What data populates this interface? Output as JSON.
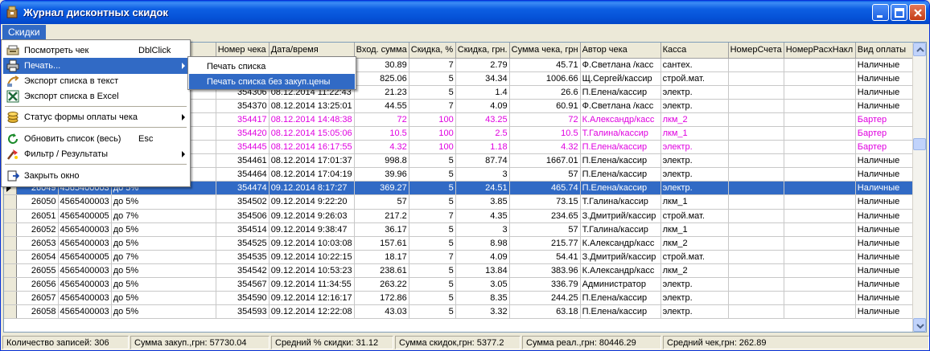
{
  "window": {
    "title": "Журнал дисконтных скидок"
  },
  "menubar": {
    "items": [
      "Скидки"
    ]
  },
  "dropdown": {
    "items": [
      {
        "label": "Посмотреть чек",
        "shortcut": "DblClick",
        "icon": "receipt-view-icon",
        "submenu": false
      },
      {
        "label": "Печать...",
        "shortcut": "",
        "icon": "printer-icon",
        "submenu": true,
        "highlighted": true
      },
      {
        "label": "Экспорт списка в текст",
        "shortcut": "",
        "icon": "export-text-icon",
        "submenu": false
      },
      {
        "label": "Экспорт списка в Excel",
        "shortcut": "",
        "icon": "excel-icon",
        "submenu": false
      },
      {
        "label": "Статус формы оплаты чека",
        "shortcut": "",
        "icon": "coins-icon",
        "submenu": true
      },
      {
        "label": "Обновить список (весь)",
        "shortcut": "Esc",
        "icon": "refresh-icon",
        "submenu": false
      },
      {
        "label": "Фильтр / Результаты",
        "shortcut": "",
        "icon": "filter-icon",
        "submenu": true
      },
      {
        "label": "Закрыть окно",
        "shortcut": "",
        "icon": "close-window-icon",
        "submenu": false
      }
    ]
  },
  "submenu": {
    "items": [
      {
        "label": "Печать списка",
        "highlighted": false
      },
      {
        "label": "Печать списка без закуп.цены",
        "highlighted": true
      }
    ]
  },
  "grid": {
    "columns": [
      "",
      "",
      "",
      "Номер чека",
      "Дата/время",
      "Вход. сумма",
      "Скидка, %",
      "Скидка, грн.",
      "Сумма чека, грн",
      "Автор чека",
      "Касса",
      "НомерСчета",
      "НомерРасхНакл",
      "Вид оплаты"
    ],
    "rows": [
      {
        "id": "",
        "card": "",
        "level": "",
        "receipt": "",
        "datetime": "",
        "input": "30.89",
        "pct": "7",
        "disc": "2.79",
        "total": "45.71",
        "author": "Ф.Светлана /касс",
        "kassa": "сантех.",
        "acc": "",
        "inv": "",
        "pay": "Наличные",
        "style": "normal"
      },
      {
        "id": "",
        "card": "",
        "level": "",
        "receipt": "",
        "datetime": "",
        "input": "825.06",
        "pct": "5",
        "disc": "34.34",
        "total": "1006.66",
        "author": "Щ.Сергей/кассир",
        "kassa": "строй.мат.",
        "acc": "",
        "inv": "",
        "pay": "Наличные",
        "style": "normal"
      },
      {
        "id": "",
        "card": "",
        "level": "",
        "receipt": "354306",
        "datetime": "08.12.2014 11:22:43",
        "input": "21.23",
        "pct": "5",
        "disc": "1.4",
        "total": "26.6",
        "author": "П.Елена/кассир",
        "kassa": "электр.",
        "acc": "",
        "inv": "",
        "pay": "Наличные",
        "style": "normal"
      },
      {
        "id": "",
        "card": "",
        "level": "",
        "receipt": "354370",
        "datetime": "08.12.2014 13:25:01",
        "input": "44.55",
        "pct": "7",
        "disc": "4.09",
        "total": "60.91",
        "author": "Ф.Светлана /касс",
        "kassa": "электр.",
        "acc": "",
        "inv": "",
        "pay": "Наличные",
        "style": "normal"
      },
      {
        "id": "",
        "card": "",
        "level": "",
        "receipt": "354417",
        "datetime": "08.12.2014 14:48:38",
        "input": "72",
        "pct": "100",
        "disc": "43.25",
        "total": "72",
        "author": "К.Александр/касс",
        "kassa": "лкм_2",
        "acc": "",
        "inv": "",
        "pay": "Бартер",
        "style": "pink"
      },
      {
        "id": "",
        "card": "",
        "level": "",
        "receipt": "354420",
        "datetime": "08.12.2014 15:05:06",
        "input": "10.5",
        "pct": "100",
        "disc": "2.5",
        "total": "10.5",
        "author": "Т.Галина/кассир",
        "kassa": "лкм_1",
        "acc": "",
        "inv": "",
        "pay": "Бартер",
        "style": "pink"
      },
      {
        "id": "",
        "card": "",
        "level": "а барт",
        "receipt": "354445",
        "datetime": "08.12.2014 16:17:55",
        "input": "4.32",
        "pct": "100",
        "disc": "1.18",
        "total": "4.32",
        "author": "П.Елена/кассир",
        "kassa": "электр.",
        "acc": "",
        "inv": "",
        "pay": "Бартер",
        "style": "pink"
      },
      {
        "id": "",
        "card": "",
        "level": "",
        "receipt": "354461",
        "datetime": "08.12.2014 17:01:37",
        "input": "998.8",
        "pct": "5",
        "disc": "87.74",
        "total": "1667.01",
        "author": "П.Елена/кассир",
        "kassa": "электр.",
        "acc": "",
        "inv": "",
        "pay": "Наличные",
        "style": "normal"
      },
      {
        "id": "",
        "card": "",
        "level": "",
        "receipt": "354464",
        "datetime": "08.12.2014 17:04:19",
        "input": "39.96",
        "pct": "5",
        "disc": "3",
        "total": "57",
        "author": "П.Елена/кассир",
        "kassa": "электр.",
        "acc": "",
        "inv": "",
        "pay": "Наличные",
        "style": "normal"
      },
      {
        "id": "26049",
        "card": "4565400003",
        "level": "до 5%",
        "receipt": "354474",
        "datetime": "09.12.2014 8:17:27",
        "input": "369.27",
        "pct": "5",
        "disc": "24.51",
        "total": "465.74",
        "author": "П.Елена/кассир",
        "kassa": "электр.",
        "acc": "",
        "inv": "",
        "pay": "Наличные",
        "style": "sel"
      },
      {
        "id": "26050",
        "card": "4565400003",
        "level": "до 5%",
        "receipt": "354502",
        "datetime": "09.12.2014 9:22:20",
        "input": "57",
        "pct": "5",
        "disc": "3.85",
        "total": "73.15",
        "author": "Т.Галина/кассир",
        "kassa": "лкм_1",
        "acc": "",
        "inv": "",
        "pay": "Наличные",
        "style": "normal"
      },
      {
        "id": "26051",
        "card": "4565400005",
        "level": "до 7%",
        "receipt": "354506",
        "datetime": "09.12.2014 9:26:03",
        "input": "217.2",
        "pct": "7",
        "disc": "4.35",
        "total": "234.65",
        "author": "З.Дмитрий/кассир",
        "kassa": "строй.мат.",
        "acc": "",
        "inv": "",
        "pay": "Наличные",
        "style": "normal"
      },
      {
        "id": "26052",
        "card": "4565400003",
        "level": "до 5%",
        "receipt": "354514",
        "datetime": "09.12.2014 9:38:47",
        "input": "36.17",
        "pct": "5",
        "disc": "3",
        "total": "57",
        "author": "Т.Галина/кассир",
        "kassa": "лкм_1",
        "acc": "",
        "inv": "",
        "pay": "Наличные",
        "style": "normal"
      },
      {
        "id": "26053",
        "card": "4565400003",
        "level": "до 5%",
        "receipt": "354525",
        "datetime": "09.12.2014 10:03:08",
        "input": "157.61",
        "pct": "5",
        "disc": "8.98",
        "total": "215.77",
        "author": "К.Александр/касс",
        "kassa": "лкм_2",
        "acc": "",
        "inv": "",
        "pay": "Наличные",
        "style": "normal"
      },
      {
        "id": "26054",
        "card": "4565400005",
        "level": "до 7%",
        "receipt": "354535",
        "datetime": "09.12.2014 10:22:15",
        "input": "18.17",
        "pct": "7",
        "disc": "4.09",
        "total": "54.41",
        "author": "З.Дмитрий/кассир",
        "kassa": "строй.мат.",
        "acc": "",
        "inv": "",
        "pay": "Наличные",
        "style": "normal"
      },
      {
        "id": "26055",
        "card": "4565400003",
        "level": "до 5%",
        "receipt": "354542",
        "datetime": "09.12.2014 10:53:23",
        "input": "238.61",
        "pct": "5",
        "disc": "13.84",
        "total": "383.96",
        "author": "К.Александр/касс",
        "kassa": "лкм_2",
        "acc": "",
        "inv": "",
        "pay": "Наличные",
        "style": "normal"
      },
      {
        "id": "26056",
        "card": "4565400003",
        "level": "до 5%",
        "receipt": "354567",
        "datetime": "09.12.2014 11:34:55",
        "input": "263.22",
        "pct": "5",
        "disc": "3.05",
        "total": "336.79",
        "author": "Администратор",
        "kassa": "электр.",
        "acc": "",
        "inv": "",
        "pay": "Наличные",
        "style": "normal"
      },
      {
        "id": "26057",
        "card": "4565400003",
        "level": "до 5%",
        "receipt": "354590",
        "datetime": "09.12.2014 12:16:17",
        "input": "172.86",
        "pct": "5",
        "disc": "8.35",
        "total": "244.25",
        "author": "П.Елена/кассир",
        "kassa": "электр.",
        "acc": "",
        "inv": "",
        "pay": "Наличные",
        "style": "normal"
      },
      {
        "id": "26058",
        "card": "4565400003",
        "level": "до 5%",
        "receipt": "354593",
        "datetime": "09.12.2014 12:22:08",
        "input": "43.03",
        "pct": "5",
        "disc": "3.32",
        "total": "63.18",
        "author": "П.Елена/кассир",
        "kassa": "электр.",
        "acc": "",
        "inv": "",
        "pay": "Наличные",
        "style": "normal"
      }
    ]
  },
  "status": {
    "count": "Количество записей: 306",
    "purchase_sum": "Сумма закуп.,грн: 57730.04",
    "avg_discount": "Средний % скидки: 31.12",
    "discount_sum": "Сумма скидок,грн: 5377.2",
    "sales_sum": "Сумма реал.,грн: 80446.29",
    "avg_receipt": "Средний чек,грн: 262.89"
  },
  "colors": {
    "selection": "#316ac5",
    "barter_text": "#e000e0",
    "title_blue": "#0653d8"
  }
}
